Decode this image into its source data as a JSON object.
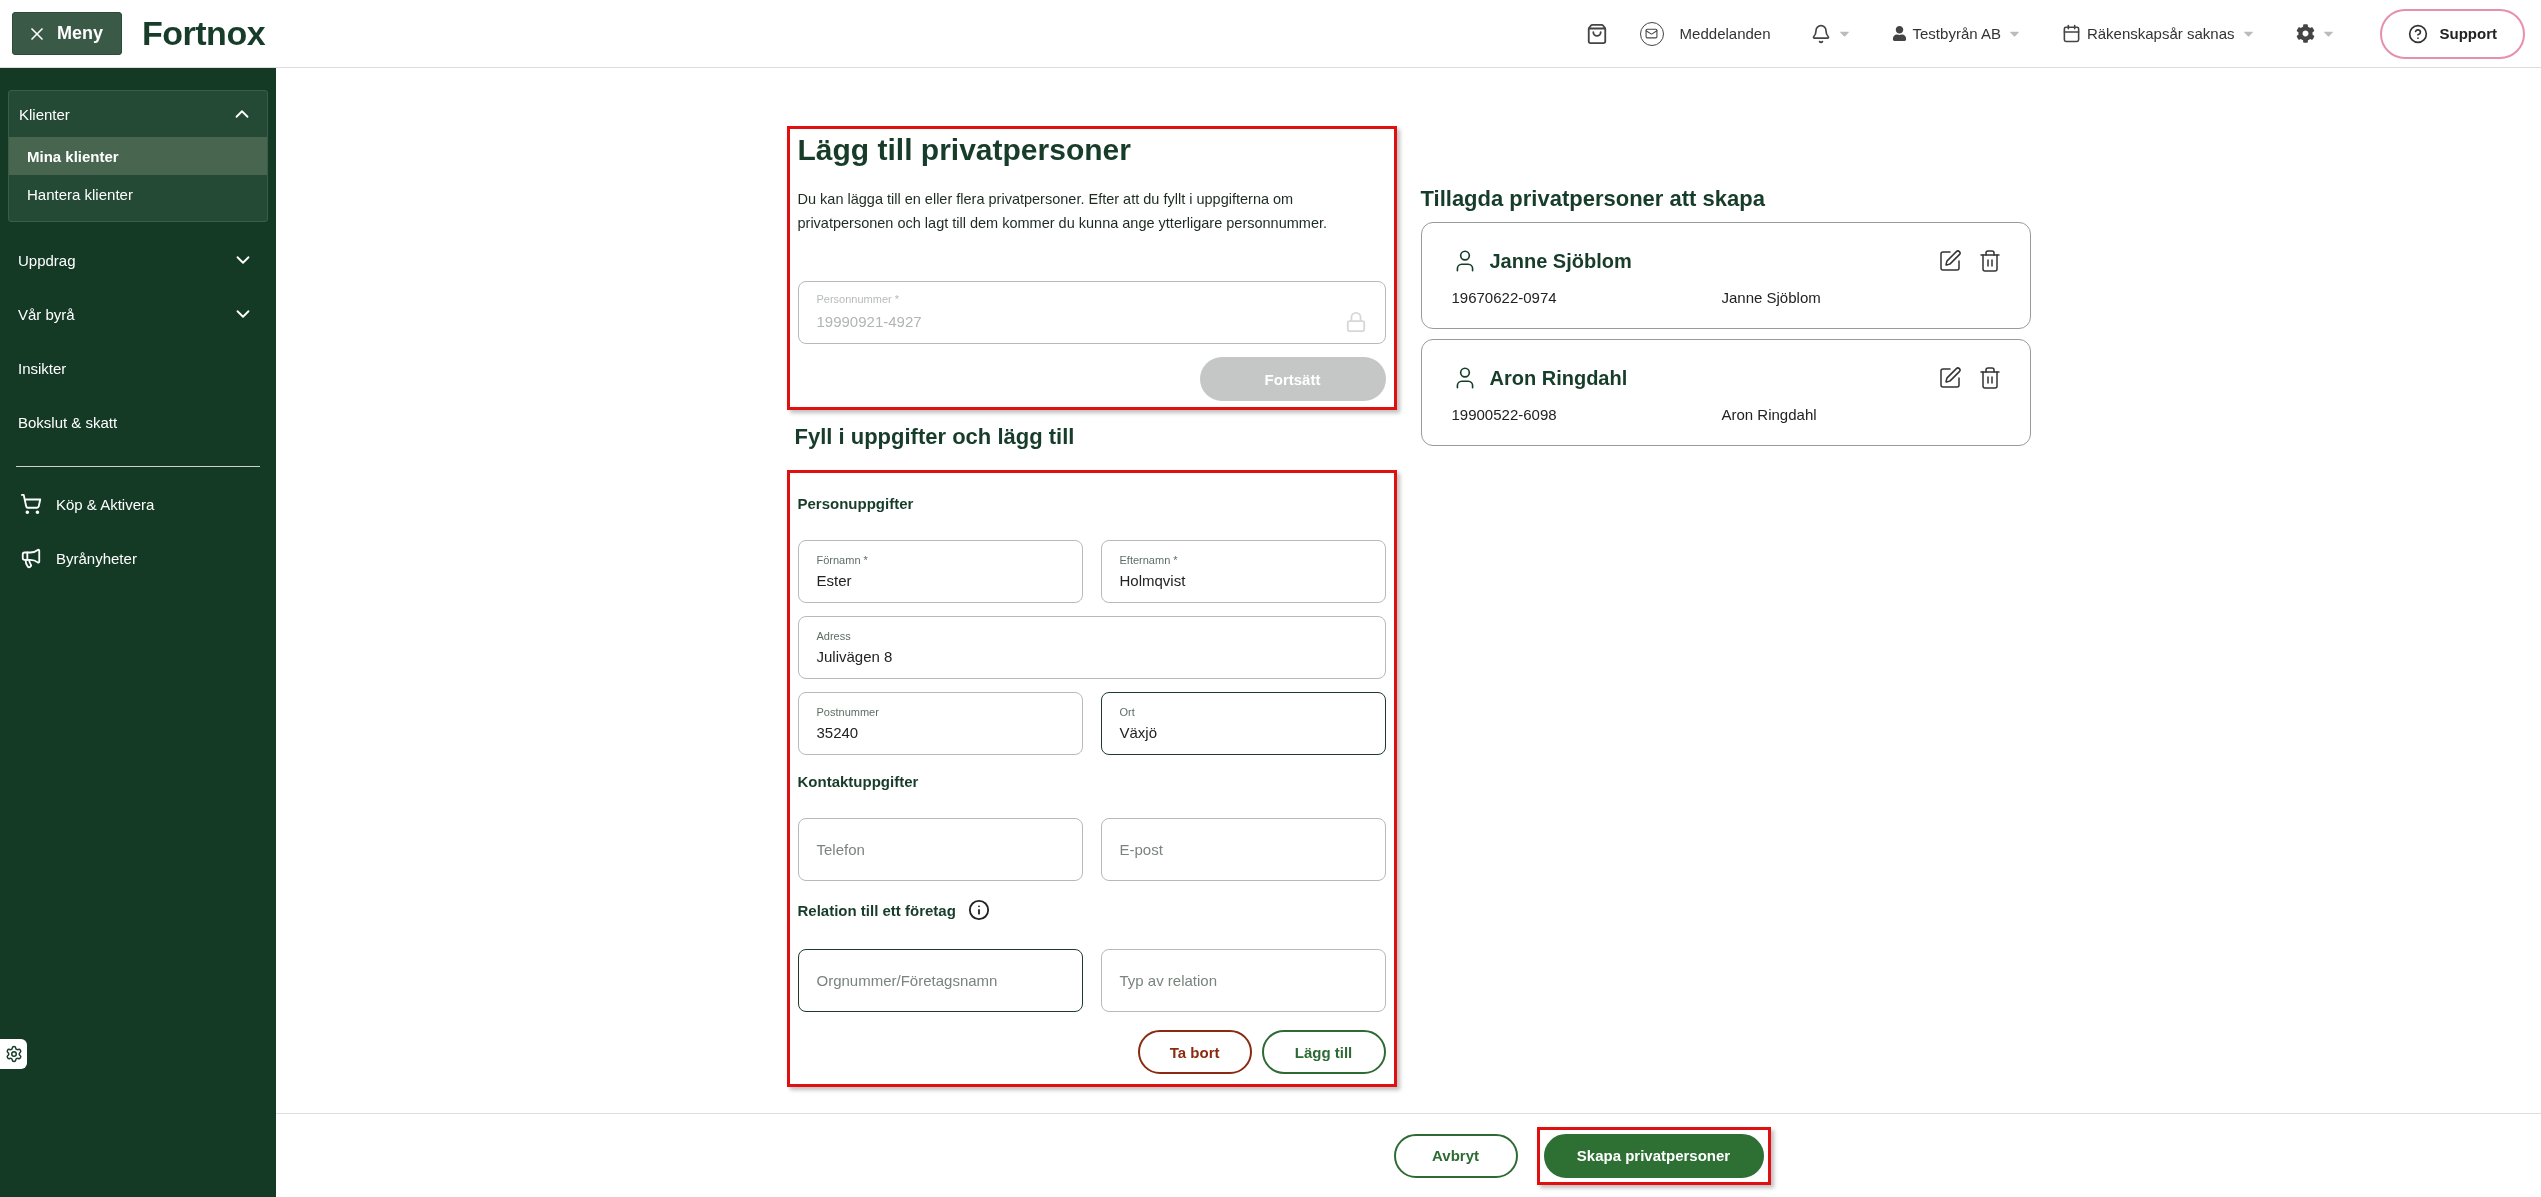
{
  "topbar": {
    "menu_button": "Meny",
    "logo": "Fortnox",
    "messages": "Meddelanden",
    "company": "Testbyrån AB",
    "fiscal_year": "Räkenskapsår saknas",
    "support": "Support"
  },
  "sidebar": {
    "items": [
      {
        "kind": "group",
        "label": "Klienter",
        "expanded": true,
        "children": [
          {
            "label": "Mina klienter",
            "selected": true
          },
          {
            "label": "Hantera klienter",
            "selected": false
          }
        ]
      },
      {
        "kind": "group",
        "label": "Uppdrag",
        "expanded": false
      },
      {
        "kind": "group",
        "label": "Vår byrå",
        "expanded": false
      },
      {
        "kind": "link",
        "label": "Insikter"
      },
      {
        "kind": "link",
        "label": "Bokslut & skatt"
      }
    ],
    "shortcuts": [
      {
        "kind": "cart",
        "label": "Köp & Aktivera"
      },
      {
        "kind": "megaphone",
        "label": "Byrånyheter"
      }
    ]
  },
  "intro": {
    "title": "Lägg till privatpersoner",
    "text": "Du kan lägga till en eller flera privatpersoner. Efter att du fyllt i uppgifterna om privatpersonen och lagt till dem kommer du kunna ange ytterligare personnummer.",
    "highlighted": true,
    "personnummer": {
      "label": "Personnummer *",
      "value": "19990921-4927",
      "disabled": true
    },
    "button": {
      "label": "Fortsätt",
      "disabled": true
    }
  },
  "entry_form": {
    "heading": "Fyll i uppgifter och lägg till",
    "highlighted": true,
    "sections": [
      {
        "title": "Personuppgifter",
        "info": false,
        "rows": [
          [
            {
              "label": "Förnamn *",
              "value": "Ester",
              "active": false
            },
            {
              "label": "Efternamn *",
              "value": "Holmqvist",
              "active": false
            }
          ],
          [
            {
              "label": "Adress",
              "value": "Julivägen 8",
              "active": false
            }
          ],
          [
            {
              "label": "Postnummer",
              "value": "35240",
              "active": false
            },
            {
              "label": "Ort",
              "value": "Växjö",
              "active": true
            }
          ]
        ]
      },
      {
        "title": "Kontaktuppgifter",
        "info": false,
        "rows": [
          [
            {
              "placeholder": "Telefon",
              "active": false
            },
            {
              "placeholder": "E-post",
              "active": false
            }
          ]
        ]
      },
      {
        "title": "Relation till ett företag",
        "info": true,
        "rows": [
          [
            {
              "placeholder": "Orgnummer/Företagsnamn",
              "active": true
            },
            {
              "placeholder": "Typ av relation",
              "active": false
            }
          ]
        ]
      }
    ],
    "buttons": [
      {
        "label": "Ta bort",
        "kind": "danger"
      },
      {
        "label": "Lägg till",
        "kind": "secondary"
      }
    ]
  },
  "added": {
    "heading": "Tillagda privatpersoner att skapa",
    "people": [
      {
        "name": "Janne Sjöblom",
        "personnummer": "19670622-0974",
        "full_name": "Janne Sjöblom"
      },
      {
        "name": "Aron Ringdahl",
        "personnummer": "19900522-6098",
        "full_name": "Aron Ringdahl"
      }
    ]
  },
  "footer": {
    "buttons": [
      {
        "label": "Avbryt",
        "kind": "secondary",
        "highlighted": false
      },
      {
        "label": "Skapa privatpersoner",
        "kind": "primary",
        "highlighted": true
      }
    ]
  }
}
